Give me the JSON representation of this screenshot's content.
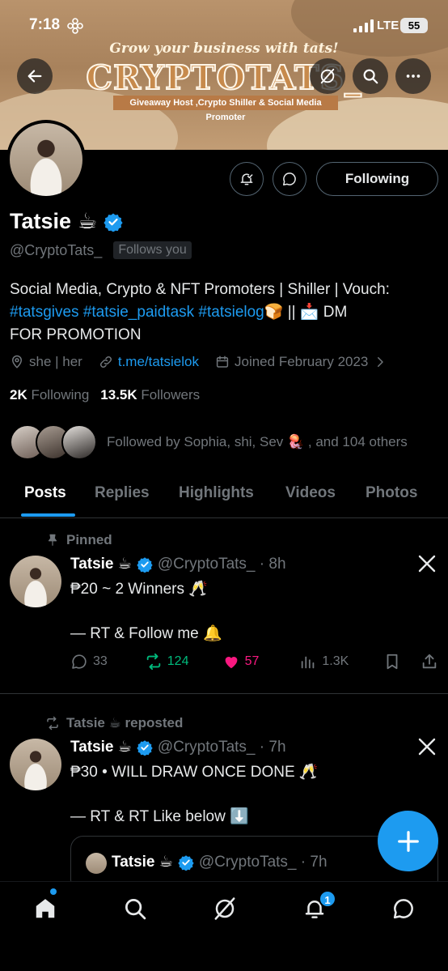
{
  "status_bar": {
    "time": "7:18",
    "network": "LTE",
    "battery": "55"
  },
  "banner": {
    "tagline": "Grow your business with tats!",
    "brand": "CRYPTOTATS_",
    "subline": "Giveaway Host ,Crypto Shiller & Social Media Promoter"
  },
  "profile": {
    "name": "Tatsie",
    "name_emoji": "☕",
    "handle": "@CryptoTats_",
    "follows_you": "Follows you",
    "follow_button": "Following",
    "bio_line1": "Social Media, Crypto & NFT Promoters | Shiller | Vouch:",
    "bio_tags": "#tatsgives #tatsie_paidtask #tatsielog",
    "bio_after_tags": "🍞 || 📩 DM",
    "bio_line3": "FOR PROMOTION",
    "pronouns": "she | her",
    "link": "t.me/tatsielok",
    "joined": "Joined February 2023",
    "following_count": "2K",
    "following_label": "Following",
    "followers_count": "13.5K",
    "followers_label": "Followers",
    "followed_by": "Followed by Sophia, shi, Sev 🪼 , and 104 others"
  },
  "tabs": [
    "Posts",
    "Replies",
    "Highlights",
    "Videos",
    "Photos"
  ],
  "posts": [
    {
      "context": "Pinned",
      "name": "Tatsie ☕",
      "handle": "@CryptoTats_ · 8h",
      "line1": "₱20 ~ 2 Winners 🥂",
      "line2": "— RT & Follow me 🔔",
      "replies": "33",
      "reposts": "124",
      "likes": "57",
      "views": "1.3K"
    },
    {
      "context": "Tatsie ☕ reposted",
      "name": "Tatsie ☕",
      "handle": "@CryptoTats_ · 7h",
      "line1": "₱30 • WILL DRAW ONCE DONE  🥂",
      "line2": "— RT & RT Like below ⬇️",
      "quote_name": "Tatsie ☕",
      "quote_handle": "@CryptoTats_ · 7h"
    }
  ],
  "bottom_nav": {
    "notification_badge": "1"
  },
  "colors": {
    "accent": "#1d9bf0",
    "repost": "#00ba7c",
    "like": "#f91880"
  }
}
